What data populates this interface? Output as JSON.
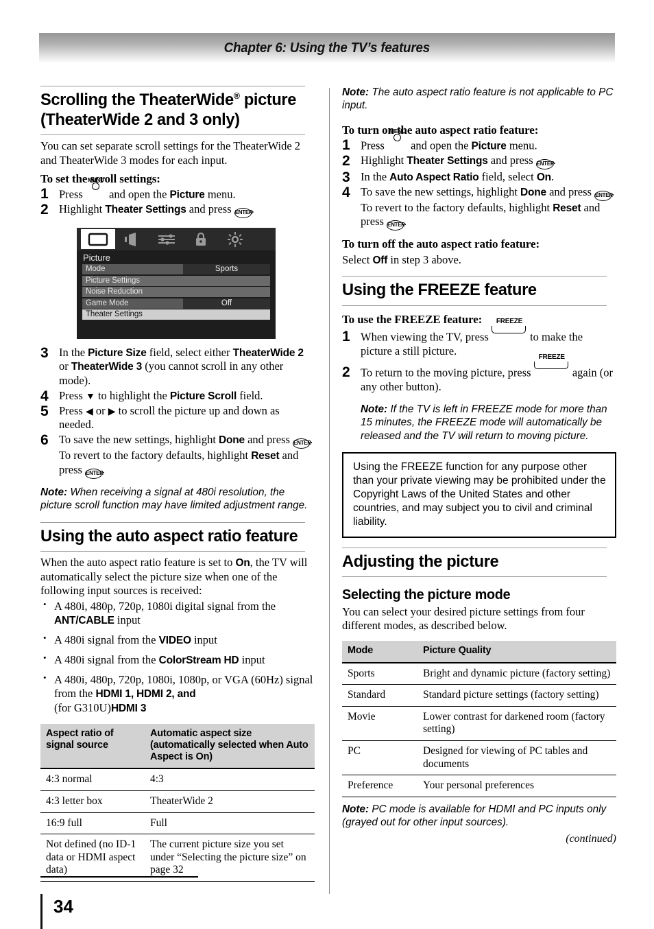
{
  "header": {
    "chapter_title": "Chapter 6: Using the TV’s features"
  },
  "footer": {
    "page_number": "34",
    "continued": "(continued)"
  },
  "left_column": {
    "section1": {
      "heading_line1": "Scrolling the TheaterWide",
      "heading_sup": "®",
      "heading_line1_tail": " picture",
      "heading_line2": "(TheaterWide 2 and 3 only)",
      "intro": "You can set separate scroll settings for the TheaterWide 2 and TheaterWide 3 modes for each input.",
      "procedure_heading": "To set the scroll settings:",
      "step1_pre": "Press",
      "step1_key": "MENU",
      "step1_post": " and open the ",
      "step1_bold": "Picture",
      "step1_end": " menu.",
      "step2_pre": "Highlight ",
      "step2_bold": "Theater Settings",
      "step2_post": " and press ",
      "step2_key": "ENTER",
      "step2_end": ".",
      "step3_a": "In the ",
      "step3_b1": "Picture Size",
      "step3_b": " field, select either ",
      "step3_b2": "TheaterWide 2",
      "step3_c": " or ",
      "step3_b3": "TheaterWide 3",
      "step3_d": " (you cannot scroll in any other mode).",
      "step4_a": "Press ",
      "step4_arrow": "▼",
      "step4_b": " to highlight the ",
      "step4_bold": "Picture Scroll",
      "step4_c": " field.",
      "step5_a": "Press ",
      "step5_arrow1": "◀",
      "step5_b": " or ",
      "step5_arrow2": "▶",
      "step5_c": " to scroll the picture up and down as needed.",
      "step6_a": "To save the new settings, highlight ",
      "step6_b1": "Done",
      "step6_b": " and press ",
      "step6_key1": "ENTER",
      "step6_c": ". To revert to the factory defaults, highlight ",
      "step6_b2": "Reset",
      "step6_d": " and press ",
      "step6_key2": "ENTER",
      "step6_e": ".",
      "note_label": "Note:",
      "note_text": " When receiving a signal at 480i resolution, the picture scroll function may have limited adjustment range."
    },
    "tv_menu": {
      "icons": [
        "picture-icon",
        "sound-icon",
        "settings-sliders-icon",
        "lock-icon",
        "setup-gear-icon"
      ],
      "selected_icon_index": 0,
      "title": "Picture",
      "rows": [
        {
          "label": "Mode",
          "value": "Sports",
          "style": "value"
        },
        {
          "label": "Picture Settings",
          "value": "",
          "style": "plain"
        },
        {
          "label": "Noise Reduction",
          "value": "",
          "style": "plain"
        },
        {
          "label": "Game Mode",
          "value": "Off",
          "style": "value"
        },
        {
          "label": "Theater Settings",
          "value": "",
          "style": "highlight"
        }
      ]
    },
    "section2": {
      "heading": "Using the auto aspect ratio feature",
      "intro_a": "When the auto aspect ratio feature is set to ",
      "intro_on": "On",
      "intro_b": ", the TV will automatically select the picture size when one of the following input sources is received:",
      "bullets": [
        {
          "a": "A 480i, 480p, 720p, 1080i digital signal from the ",
          "b": "ANT/CABLE",
          "c": " input"
        },
        {
          "a": "A 480i signal from the  ",
          "b": "VIDEO",
          "c": " input"
        },
        {
          "a": "A 480i signal from the ",
          "b": "ColorStream HD",
          "c": " input"
        },
        {
          "a": "A 480i, 480p, 720p, 1080i, 1080p, or VGA (60Hz) signal from the ",
          "b": "HDMI 1, HDMI 2, and",
          "c": "",
          "d": "(for G310U)",
          "e": "HDMI 3"
        }
      ]
    },
    "aspect_table": {
      "headers": [
        "Aspect ratio of signal source",
        "Automatic aspect size (automatically selected when Auto Aspect is On)"
      ],
      "rows": [
        [
          "4:3 normal",
          "4:3"
        ],
        [
          "4:3 letter box",
          "TheaterWide 2"
        ],
        [
          "16:9 full",
          "Full"
        ],
        [
          "Not defined (no ID-1 data or HDMI aspect data)",
          "The current picture size you set under “Selecting the picture size” on page 32"
        ]
      ]
    }
  },
  "right_column": {
    "note_top": {
      "label": "Note:",
      "text": " The auto aspect ratio feature is not applicable to PC input."
    },
    "turn_on": {
      "heading": "To turn on the auto aspect ratio feature:",
      "step1_pre": "Press",
      "step1_key": "MENU",
      "step1_post": " and open the ",
      "step1_bold": "Picture",
      "step1_end": " menu.",
      "step2_pre": "Highlight ",
      "step2_bold": "Theater Settings",
      "step2_post": " and press ",
      "step2_key": "ENTER",
      "step2_end": ".",
      "step3_a": "In the ",
      "step3_b1": "Auto Aspect Ratio",
      "step3_b": " field, select ",
      "step3_b2": "On",
      "step3_c": ".",
      "step4_a": "To save the new settings, highlight ",
      "step4_b1": "Done",
      "step4_b": " and press ",
      "step4_key1": "ENTER",
      "step4_c": ". To revert to the factory defaults, highlight ",
      "step4_b2": "Reset",
      "step4_d": " and press ",
      "step4_key2": "ENTER",
      "step4_e": "."
    },
    "turn_off": {
      "heading": "To turn off the auto aspect ratio feature:",
      "text_a": "Select ",
      "text_off": "Off",
      "text_b": " in step 3 above."
    },
    "freeze_section": {
      "heading": "Using the FREEZE feature",
      "procedure_heading": "To use the FREEZE feature:",
      "step1_a": "When viewing the TV, press ",
      "step1_key": "FREEZE",
      "step1_b": " to make the picture a still picture.",
      "step2_a": "To return to the moving picture, press ",
      "step2_key": "FREEZE",
      "step2_b": " again (or any other button).",
      "note_label": "Note:",
      "note_text": " If the TV is left in FREEZE mode for more than 15 minutes, the FREEZE mode will automatically be released and the TV will return to moving picture.",
      "warning": "Using the FREEZE function for any purpose other than your private viewing may be prohibited under the Copyright Laws of the United States and other countries, and may subject you to civil and criminal liability."
    },
    "adjusting": {
      "heading": "Adjusting the picture",
      "subheading": "Selecting the picture mode",
      "intro": "You can select your desired picture settings from four different modes, as described below."
    },
    "mode_table": {
      "headers": [
        "Mode",
        "Picture Quality"
      ],
      "rows": [
        [
          "Sports",
          "Bright and dynamic picture (factory setting)"
        ],
        [
          "Standard",
          "Standard picture settings (factory setting)"
        ],
        [
          "Movie",
          "Lower contrast for darkened room (factory setting)"
        ],
        [
          "PC",
          "Designed for viewing of PC tables and documents"
        ],
        [
          "Preference",
          "Your personal preferences"
        ]
      ]
    },
    "note_bottom": {
      "label": "Note:",
      "text": " PC mode is available for HDMI and PC inputs only (grayed out for other input sources)."
    }
  }
}
